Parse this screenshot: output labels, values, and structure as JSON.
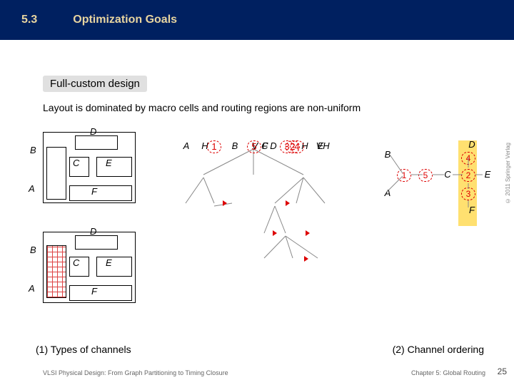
{
  "header": {
    "num": "5.3",
    "title": "Optimization Goals"
  },
  "heading": "Full-custom design",
  "body": "Layout is dominated by macro cells and routing regions are non-uniform",
  "cells": {
    "A": "A",
    "B": "B",
    "C": "C",
    "D": "D",
    "E": "E",
    "F": "F"
  },
  "graph": {
    "V": "V",
    "H1": "H",
    "H2": "H",
    "H3": "H",
    "n5": "5",
    "A": "A",
    "n1": "1",
    "B": "B",
    "D": "D",
    "n4": "4",
    "F": "F",
    "n3": "3",
    "C": "C",
    "n2": "2",
    "E": "E"
  },
  "order": {
    "B": "B",
    "D": "D",
    "n4": "4",
    "n1": "1",
    "n5": "5",
    "C": "C",
    "n2": "2",
    "E": "E",
    "A": "A",
    "n3": "3",
    "F": "F"
  },
  "caption1": "(1) Types of channels",
  "caption2": "(2) Channel ordering",
  "footer": {
    "left": "VLSI Physical Design: From Graph Partitioning to Timing Closure",
    "right": "Chapter 5: Global Routing",
    "page": "25",
    "copy": "© 2011 Springer Verlag"
  }
}
